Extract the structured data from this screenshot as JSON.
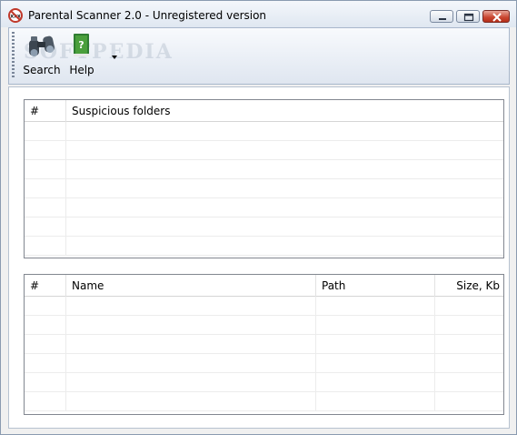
{
  "window": {
    "title": "Parental Scanner 2.0 - Unregistered version"
  },
  "toolbar": {
    "search_label": "Search",
    "help_label": "Help",
    "watermark": "SOFTPEDIA"
  },
  "folders_table": {
    "columns": [
      "#",
      "Suspicious folders"
    ],
    "row_count": 7
  },
  "files_table": {
    "columns": [
      "#",
      "Name",
      "Path",
      "Size, Kb"
    ],
    "row_count": 6
  },
  "colors": {
    "titlebar": "#dfe7f1",
    "close_button": "#c9452f",
    "grid_border": "#828790"
  },
  "icons": {
    "app": "no-symbol-icon",
    "search": "binoculars-icon",
    "help": "help-book-icon"
  }
}
